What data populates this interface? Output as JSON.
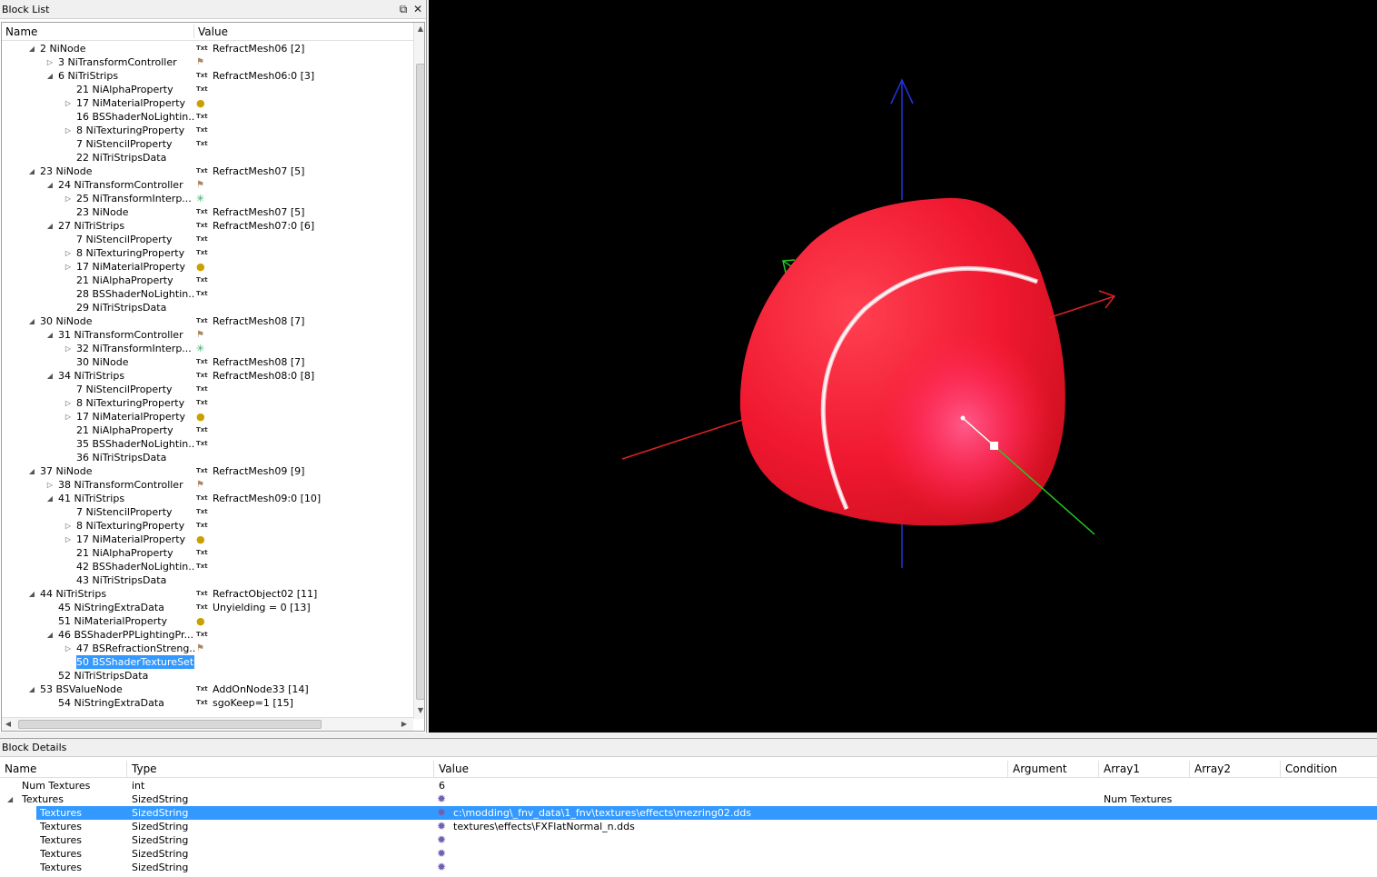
{
  "block_list": {
    "title": "Block List",
    "columns": {
      "name": "Name",
      "value": "Value"
    },
    "rows": [
      {
        "depth": 0,
        "exp": "open",
        "label": "2 NiNode",
        "icon": "txt",
        "value": "RefractMesh06 [2]"
      },
      {
        "depth": 1,
        "exp": "closed",
        "label": "3 NiTransformController",
        "icon": "ctrl",
        "value": ""
      },
      {
        "depth": 1,
        "exp": "open",
        "label": "6 NiTriStrips",
        "icon": "txt",
        "value": "RefractMesh06:0 [3]"
      },
      {
        "depth": 2,
        "exp": "none",
        "label": "21 NiAlphaProperty",
        "icon": "txt",
        "value": ""
      },
      {
        "depth": 2,
        "exp": "closed",
        "label": "17 NiMaterialProperty",
        "icon": "mat",
        "value": ""
      },
      {
        "depth": 2,
        "exp": "none",
        "label": "16 BSShaderNoLightin...",
        "icon": "txt",
        "value": ""
      },
      {
        "depth": 2,
        "exp": "closed",
        "label": "8 NiTexturingProperty",
        "icon": "txt",
        "value": ""
      },
      {
        "depth": 2,
        "exp": "none",
        "label": "7 NiStencilProperty",
        "icon": "txt",
        "value": ""
      },
      {
        "depth": 2,
        "exp": "none",
        "label": "22 NiTriStripsData",
        "icon": "",
        "value": ""
      },
      {
        "depth": 0,
        "exp": "open",
        "label": "23 NiNode",
        "icon": "txt",
        "value": "RefractMesh07 [5]"
      },
      {
        "depth": 1,
        "exp": "open",
        "label": "24 NiTransformController",
        "icon": "ctrl",
        "value": ""
      },
      {
        "depth": 2,
        "exp": "closed",
        "label": "25 NiTransformInterp...",
        "icon": "interp",
        "value": ""
      },
      {
        "depth": 2,
        "exp": "none",
        "label": "23 NiNode",
        "icon": "txt",
        "value": "RefractMesh07 [5]"
      },
      {
        "depth": 1,
        "exp": "open",
        "label": "27 NiTriStrips",
        "icon": "txt",
        "value": "RefractMesh07:0 [6]"
      },
      {
        "depth": 2,
        "exp": "none",
        "label": "7 NiStencilProperty",
        "icon": "txt",
        "value": ""
      },
      {
        "depth": 2,
        "exp": "closed",
        "label": "8 NiTexturingProperty",
        "icon": "txt",
        "value": ""
      },
      {
        "depth": 2,
        "exp": "closed",
        "label": "17 NiMaterialProperty",
        "icon": "mat",
        "value": ""
      },
      {
        "depth": 2,
        "exp": "none",
        "label": "21 NiAlphaProperty",
        "icon": "txt",
        "value": ""
      },
      {
        "depth": 2,
        "exp": "none",
        "label": "28 BSShaderNoLightin...",
        "icon": "txt",
        "value": ""
      },
      {
        "depth": 2,
        "exp": "none",
        "label": "29 NiTriStripsData",
        "icon": "",
        "value": ""
      },
      {
        "depth": 0,
        "exp": "open",
        "label": "30 NiNode",
        "icon": "txt",
        "value": "RefractMesh08 [7]"
      },
      {
        "depth": 1,
        "exp": "open",
        "label": "31 NiTransformController",
        "icon": "ctrl",
        "value": ""
      },
      {
        "depth": 2,
        "exp": "closed",
        "label": "32 NiTransformInterp...",
        "icon": "interp",
        "value": ""
      },
      {
        "depth": 2,
        "exp": "none",
        "label": "30 NiNode",
        "icon": "txt",
        "value": "RefractMesh08 [7]"
      },
      {
        "depth": 1,
        "exp": "open",
        "label": "34 NiTriStrips",
        "icon": "txt",
        "value": "RefractMesh08:0 [8]"
      },
      {
        "depth": 2,
        "exp": "none",
        "label": "7 NiStencilProperty",
        "icon": "txt",
        "value": ""
      },
      {
        "depth": 2,
        "exp": "closed",
        "label": "8 NiTexturingProperty",
        "icon": "txt",
        "value": ""
      },
      {
        "depth": 2,
        "exp": "closed",
        "label": "17 NiMaterialProperty",
        "icon": "mat",
        "value": ""
      },
      {
        "depth": 2,
        "exp": "none",
        "label": "21 NiAlphaProperty",
        "icon": "txt",
        "value": ""
      },
      {
        "depth": 2,
        "exp": "none",
        "label": "35 BSShaderNoLightin...",
        "icon": "txt",
        "value": ""
      },
      {
        "depth": 2,
        "exp": "none",
        "label": "36 NiTriStripsData",
        "icon": "",
        "value": ""
      },
      {
        "depth": 0,
        "exp": "open",
        "label": "37 NiNode",
        "icon": "txt",
        "value": "RefractMesh09 [9]"
      },
      {
        "depth": 1,
        "exp": "closed",
        "label": "38 NiTransformController",
        "icon": "ctrl",
        "value": ""
      },
      {
        "depth": 1,
        "exp": "open",
        "label": "41 NiTriStrips",
        "icon": "txt",
        "value": "RefractMesh09:0 [10]"
      },
      {
        "depth": 2,
        "exp": "none",
        "label": "7 NiStencilProperty",
        "icon": "txt",
        "value": ""
      },
      {
        "depth": 2,
        "exp": "closed",
        "label": "8 NiTexturingProperty",
        "icon": "txt",
        "value": ""
      },
      {
        "depth": 2,
        "exp": "closed",
        "label": "17 NiMaterialProperty",
        "icon": "mat",
        "value": ""
      },
      {
        "depth": 2,
        "exp": "none",
        "label": "21 NiAlphaProperty",
        "icon": "txt",
        "value": ""
      },
      {
        "depth": 2,
        "exp": "none",
        "label": "42 BSShaderNoLightin...",
        "icon": "txt",
        "value": ""
      },
      {
        "depth": 2,
        "exp": "none",
        "label": "43 NiTriStripsData",
        "icon": "",
        "value": ""
      },
      {
        "depth": 0,
        "exp": "open",
        "label": "44 NiTriStrips",
        "icon": "txt",
        "value": "RefractObject02 [11]"
      },
      {
        "depth": 1,
        "exp": "none",
        "label": "45 NiStringExtraData",
        "icon": "txt",
        "value": "Unyielding = 0 [13]"
      },
      {
        "depth": 1,
        "exp": "none",
        "label": "51 NiMaterialProperty",
        "icon": "mat",
        "value": ""
      },
      {
        "depth": 1,
        "exp": "open",
        "label": "46 BSShaderPPLightingPr...",
        "icon": "txt",
        "value": ""
      },
      {
        "depth": 2,
        "exp": "closed",
        "label": "47 BSRefractionStreng...",
        "icon": "ctrl",
        "value": ""
      },
      {
        "depth": 2,
        "exp": "none",
        "label": "50 BSShaderTextureSet",
        "icon": "",
        "value": "",
        "selected": true
      },
      {
        "depth": 1,
        "exp": "none",
        "label": "52 NiTriStripsData",
        "icon": "",
        "value": ""
      },
      {
        "depth": 0,
        "exp": "open",
        "label": "53 BSValueNode",
        "icon": "txt",
        "value": "AddOnNode33 [14]"
      },
      {
        "depth": 1,
        "exp": "none",
        "label": "54 NiStringExtraData",
        "icon": "txt",
        "value": "sgoKeep=1 [15]"
      }
    ],
    "icons": {
      "txt": "Txt",
      "mat": "palette-icon",
      "ctrl": "flag-icon",
      "interp": "axes-icon"
    }
  },
  "viewport": {
    "background": "#000000",
    "axis_colors": {
      "x": "#dd2222",
      "y": "#22cc22",
      "z": "#2233dd"
    },
    "mesh_color": "#ff2a3a"
  },
  "block_details": {
    "title": "Block Details",
    "columns": {
      "name": "Name",
      "type": "Type",
      "value": "Value",
      "argument": "Argument",
      "array1": "Array1",
      "array2": "Array2",
      "condition": "Condition"
    },
    "rows": [
      {
        "name": "Num Textures",
        "indent": 0,
        "exp": "none",
        "type": "int",
        "value": "6",
        "icon": false,
        "array1": ""
      },
      {
        "name": "Textures",
        "indent": 0,
        "exp": "open",
        "type": "SizedString",
        "value": "",
        "icon": true,
        "array1": "Num Textures"
      },
      {
        "name": "Textures",
        "indent": 1,
        "exp": "none",
        "type": "SizedString",
        "value": "c:\\modding\\_fnv_data\\1_fnv\\textures\\effects\\mezring02.dds",
        "icon": true,
        "array1": "",
        "selected": true
      },
      {
        "name": "Textures",
        "indent": 1,
        "exp": "none",
        "type": "SizedString",
        "value": "textures\\effects\\FXFlatNormal_n.dds",
        "icon": true,
        "array1": ""
      },
      {
        "name": "Textures",
        "indent": 1,
        "exp": "none",
        "type": "SizedString",
        "value": "",
        "icon": true,
        "array1": ""
      },
      {
        "name": "Textures",
        "indent": 1,
        "exp": "none",
        "type": "SizedString",
        "value": "",
        "icon": true,
        "array1": ""
      },
      {
        "name": "Textures",
        "indent": 1,
        "exp": "none",
        "type": "SizedString",
        "value": "",
        "icon": true,
        "array1": ""
      }
    ]
  }
}
